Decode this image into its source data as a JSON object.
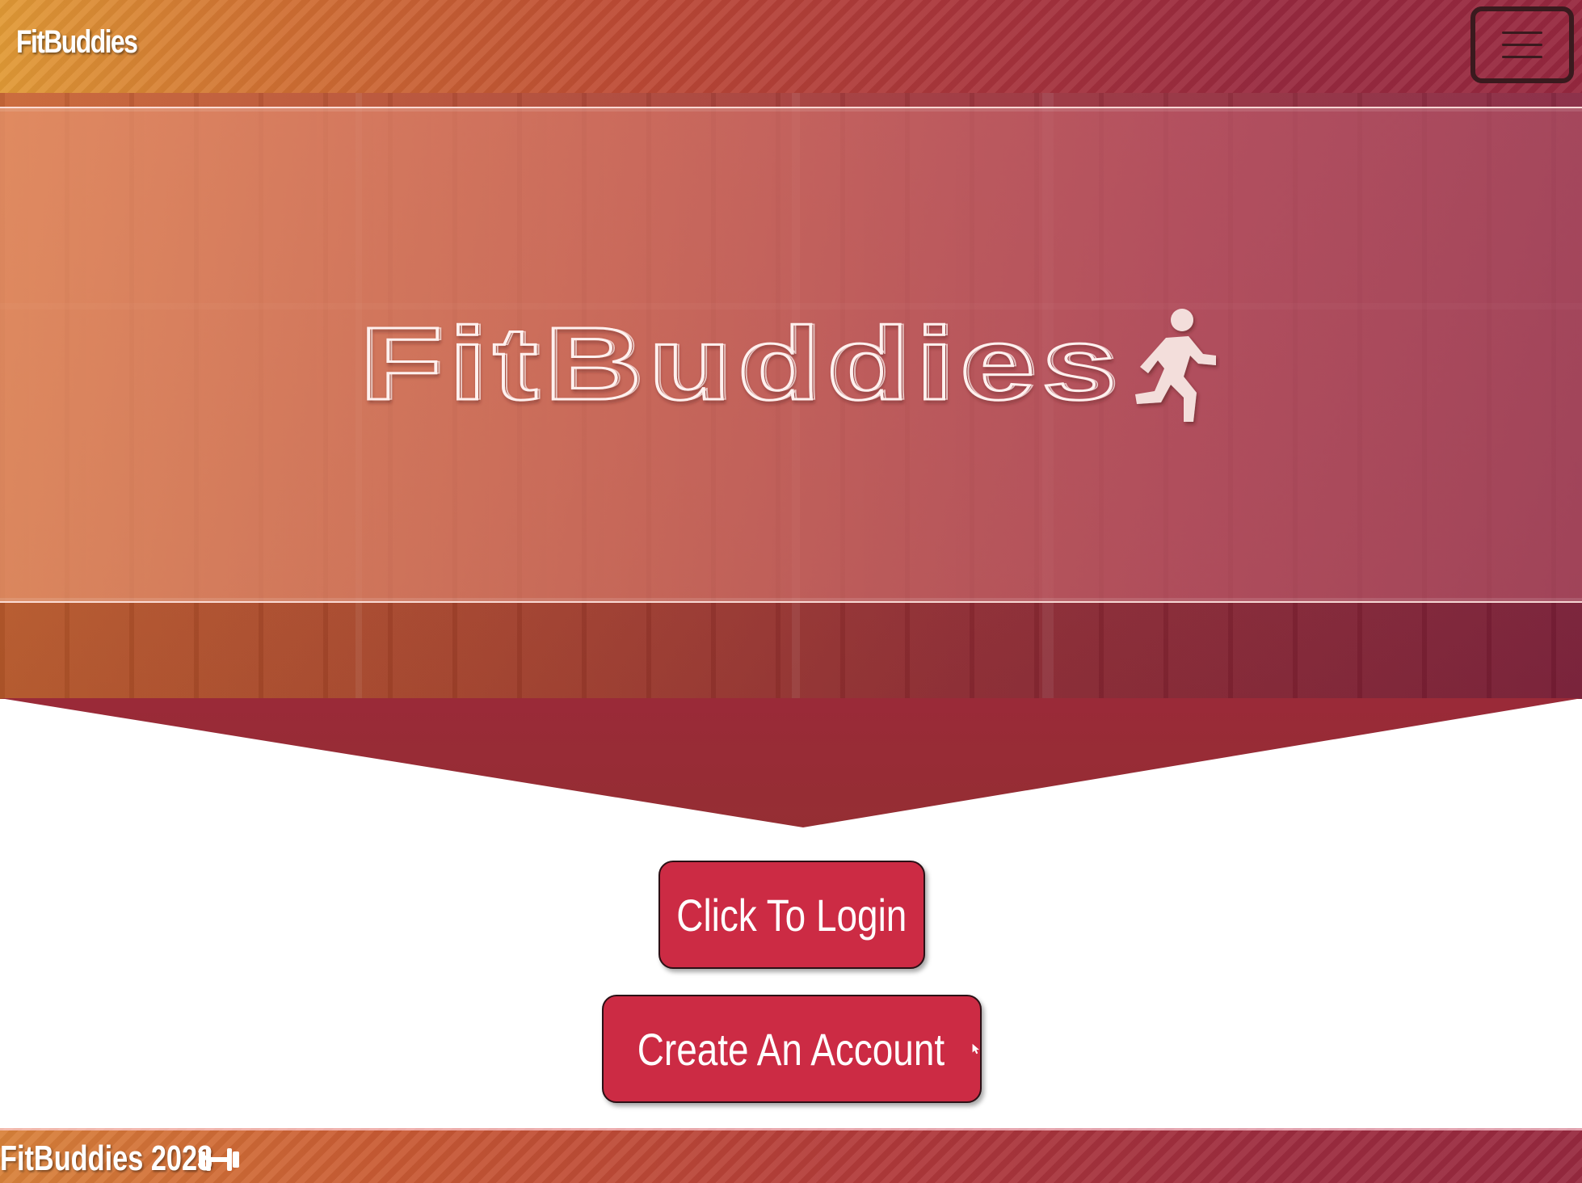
{
  "navbar": {
    "brand": "FitBuddies",
    "menu_icon": "hamburger-menu-icon"
  },
  "hero": {
    "logo_text": "FitBuddies",
    "logo_icon": "running-person-icon"
  },
  "actions": {
    "login_label": "Click To Login",
    "create_account_label": "Create An Account",
    "create_account_icon": "mouse-pointer-icon"
  },
  "footer": {
    "text": "FitBuddies 2023",
    "icon": "dumbbell-icon"
  },
  "colors": {
    "button": "#cc2b44",
    "chevron": "#952e35",
    "brand_orange": "#e19a36",
    "brand_crimson": "#97283f"
  }
}
